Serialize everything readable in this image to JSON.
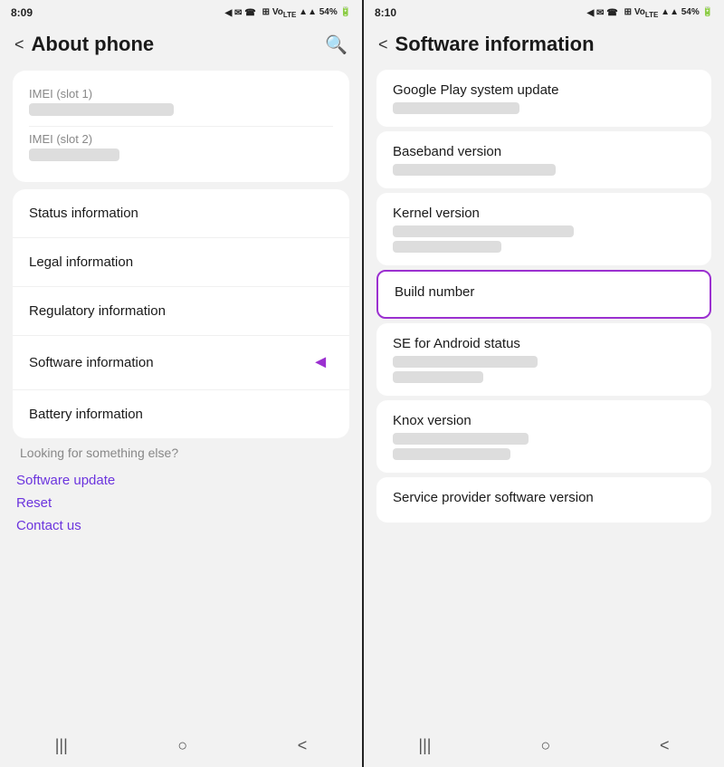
{
  "left_panel": {
    "status_bar": {
      "time": "8:09",
      "icons": "◀ ✉ ☎ ☰ | ☰ Vo LTE ▲▲ 54% 🔋"
    },
    "header": {
      "title": "About phone",
      "back_label": "<",
      "search_label": "🔍"
    },
    "imei_section": {
      "slot1_label": "IMEI (slot 1)",
      "slot2_label": "IMEI (slot 2)"
    },
    "menu_items": [
      {
        "id": "status",
        "label": "Status information"
      },
      {
        "id": "legal",
        "label": "Legal information"
      },
      {
        "id": "regulatory",
        "label": "Regulatory information"
      },
      {
        "id": "software",
        "label": "Software information"
      },
      {
        "id": "battery",
        "label": "Battery information"
      }
    ],
    "looking_section": {
      "title": "Looking for something else?",
      "links": [
        {
          "id": "update",
          "label": "Software update"
        },
        {
          "id": "reset",
          "label": "Reset"
        },
        {
          "id": "contact",
          "label": "Contact us"
        }
      ]
    },
    "nav_bar": {
      "menu_icon": "|||",
      "home_icon": "○",
      "back_icon": "<"
    }
  },
  "right_panel": {
    "status_bar": {
      "time": "8:10",
      "icons": "◀ ✉ ☎ ☰ | ☰ Vo LTE ▲▲ 54% 🔋"
    },
    "header": {
      "title": "Software information",
      "back_label": "<"
    },
    "info_items": [
      {
        "id": "google-play",
        "label": "Google Play system update"
      },
      {
        "id": "baseband",
        "label": "Baseband version"
      },
      {
        "id": "kernel",
        "label": "Kernel version"
      },
      {
        "id": "build-number",
        "label": "Build number",
        "highlighted": true
      },
      {
        "id": "se-android",
        "label": "SE for Android status"
      },
      {
        "id": "knox",
        "label": "Knox version"
      },
      {
        "id": "service-provider",
        "label": "Service provider software version"
      }
    ],
    "nav_bar": {
      "menu_icon": "|||",
      "home_icon": "○",
      "back_icon": "<"
    }
  }
}
